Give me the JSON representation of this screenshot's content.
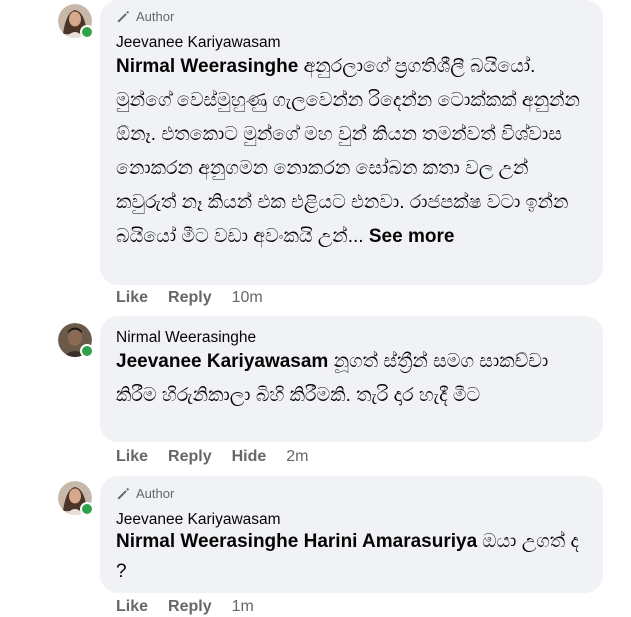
{
  "comments": [
    {
      "badge": "Author",
      "author": "Jeevanee Kariyawasam",
      "mention": "Nirmal Weerasinghe",
      "text": " අනුරලාගේ ප්‍රගතිශීලී බයියෝ. මුන්ගේ වෙස්මුහුණු ගැලවෙන්න රිදෙන්න ටොක්කක් අනුන්න ඕනෑ. එතකොට මුන්ගේ මහ වුන් කියන තමන්වත් විශ්වාස නොකරන අනුගමන නොකරන සෝබන කතා වල උන් කවුරුත් නෑ කියන් එක එළියට එනවා. රාජපක්ෂ වටා ඉන්න බයියෝ මීට වඩා අවංකයි උන්... ",
      "see_more": "See more",
      "actions": {
        "like": "Like",
        "reply": "Reply"
      },
      "time": "10m"
    },
    {
      "author": "Nirmal Weerasinghe",
      "mention": "Jeevanee Kariyawasam",
      "text": " නූගත් ස්ත්‍රීන් සමග සාකච්චා කිරීම හිරුනිකාලා බිහි කිරීමකි. තැරි දාර හැදී මීට",
      "actions": {
        "like": "Like",
        "reply": "Reply",
        "hide": "Hide"
      },
      "time": "2m"
    },
    {
      "badge": "Author",
      "author": "Jeevanee Kariyawasam",
      "mention": "Nirmal Weerasinghe Harini Amarasuriya",
      "text": " ඔයා උගත් ද ?",
      "actions": {
        "like": "Like",
        "reply": "Reply"
      },
      "time": "1m"
    }
  ],
  "colors": {
    "bubble": "#f0f2f5",
    "secondary_text": "#65676b",
    "online": "#31a24c"
  },
  "icons": [
    "pencil-icon",
    "online-dot-icon"
  ]
}
